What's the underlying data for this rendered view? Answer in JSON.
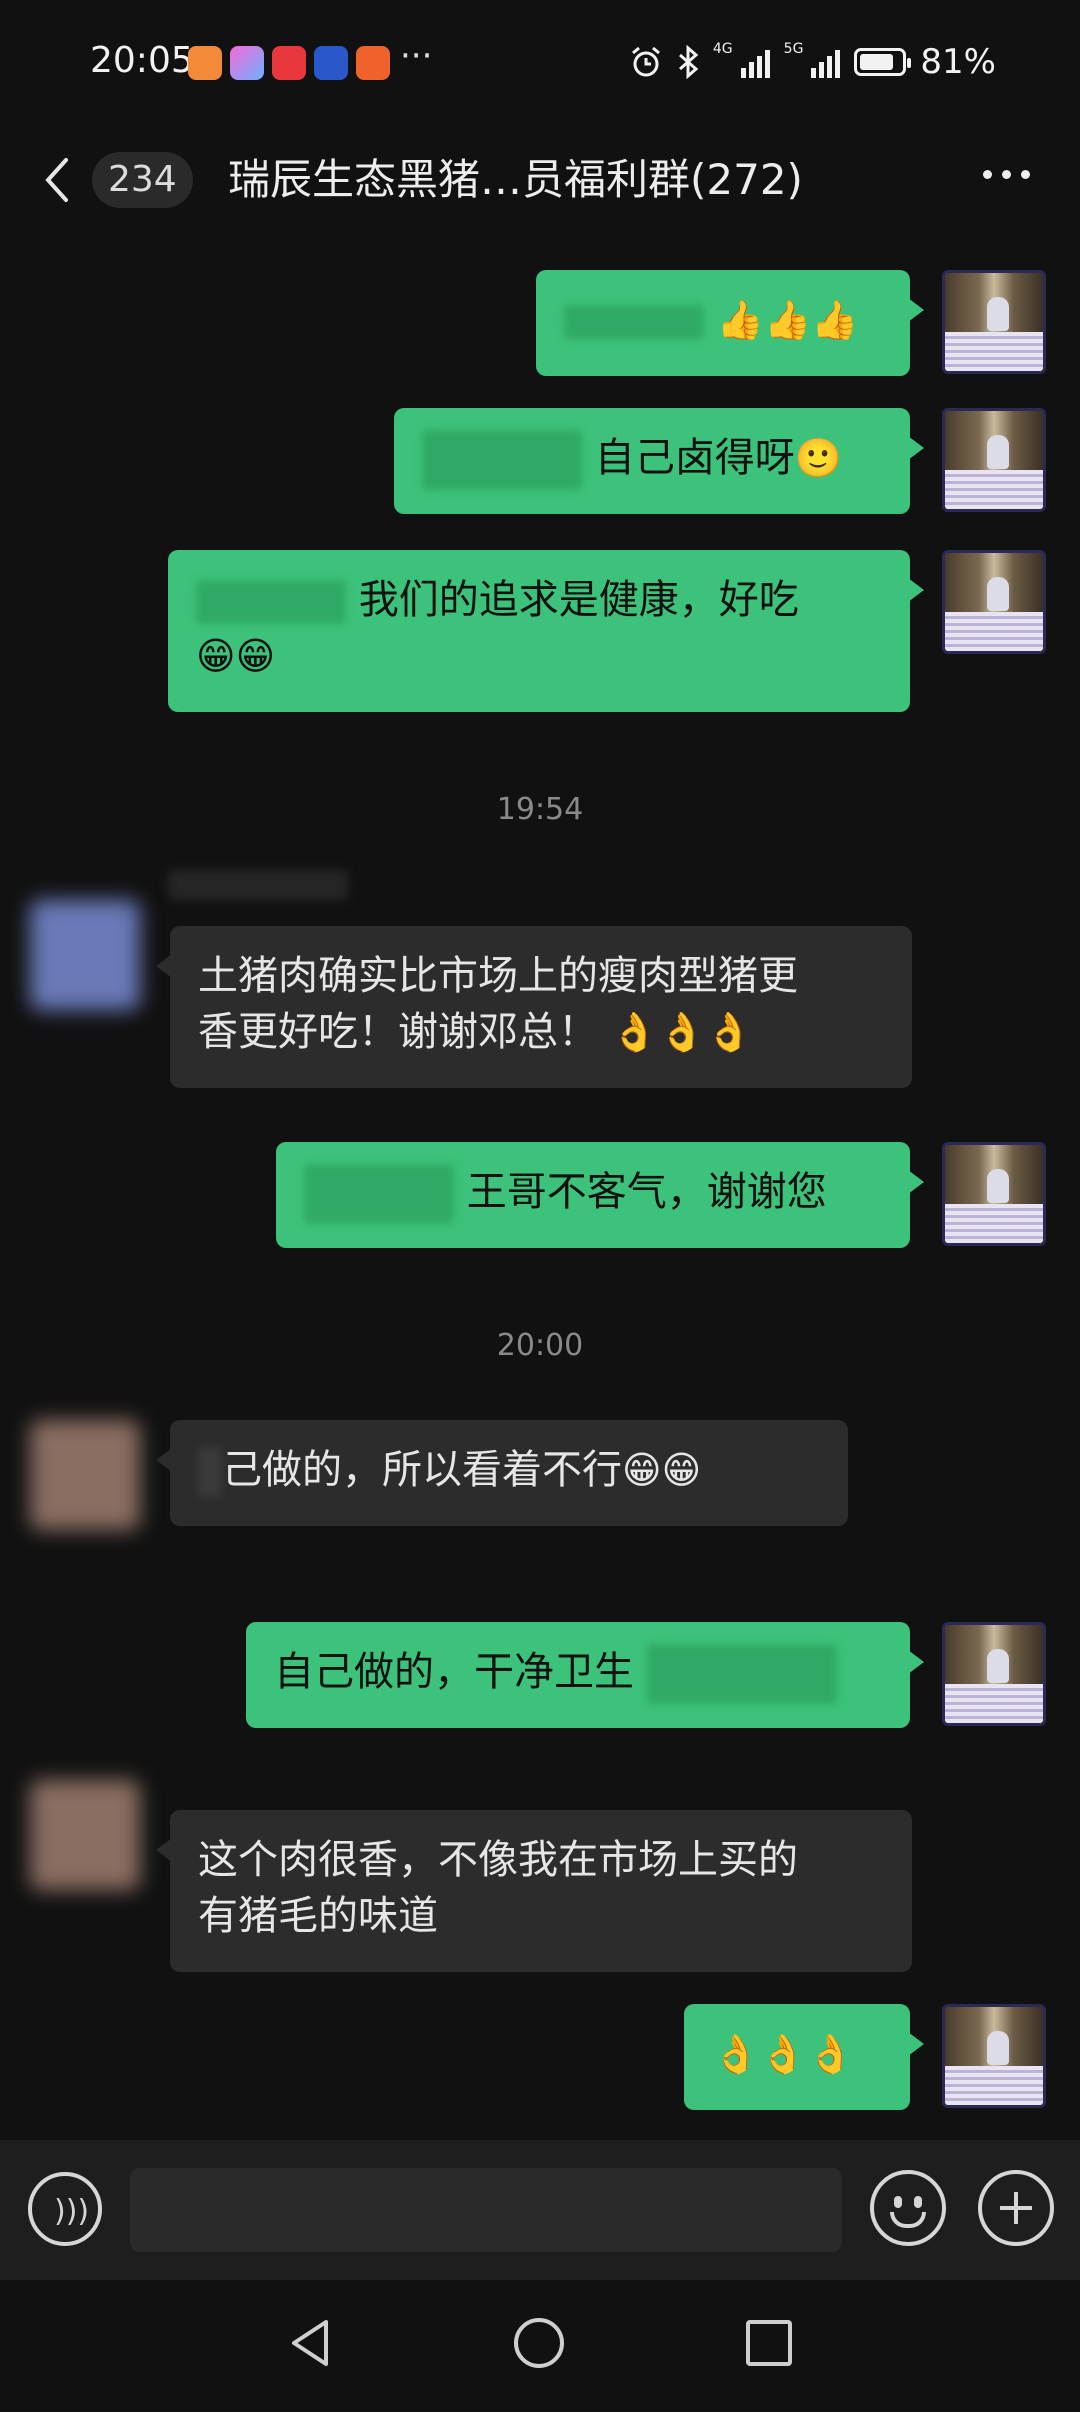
{
  "status_bar": {
    "time": "20:05",
    "more": "···",
    "network_1": "4G",
    "network_2": "5G",
    "battery_level": 0.81,
    "battery_text": "81%"
  },
  "header": {
    "unread_count": "234",
    "title": "瑞辰生态黑猪…员福利群(272)"
  },
  "messages": [
    {
      "dir": "out",
      "emoji": "👍👍👍"
    },
    {
      "dir": "out",
      "text": "自己卤得呀",
      "emoji": "🙂"
    },
    {
      "dir": "out",
      "text": "我们的追求是健康，好吃",
      "emoji": "😁😁"
    },
    {
      "type": "time",
      "text": "19:54"
    },
    {
      "dir": "in",
      "text_line1": "土猪肉确实比市场上的瘦肉型猪更",
      "text_line2": "香更好吃！谢谢邓总！",
      "emoji": "👌👌👌"
    },
    {
      "dir": "out",
      "text": "王哥不客气，谢谢您"
    },
    {
      "type": "time",
      "text": "20:00"
    },
    {
      "dir": "in",
      "text": "己做的，所以看着不行",
      "emoji": "😁😁"
    },
    {
      "dir": "out",
      "text": "自己做的，干净卫生"
    },
    {
      "dir": "in",
      "text_line1": "这个肉很香，不像我在市场上买的",
      "text_line2": "有猪毛的味道"
    },
    {
      "dir": "out",
      "emoji": "👌👌👌"
    }
  ],
  "input": {
    "placeholder": ""
  },
  "colors": {
    "outgoing_bubble": "#3cc27a",
    "incoming_bubble": "#2c2c2c",
    "background": "#111111"
  }
}
